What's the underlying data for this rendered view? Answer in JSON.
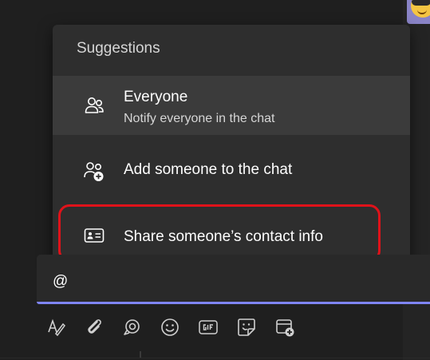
{
  "popup": {
    "title": "Suggestions",
    "items": [
      {
        "icon": "people-icon",
        "label": "Everyone",
        "sublabel": "Notify everyone in the chat"
      },
      {
        "icon": "people-add-icon",
        "label": "Add someone to the chat"
      },
      {
        "icon": "contact-card-icon",
        "label": "Share someone’s contact info"
      }
    ]
  },
  "compose": {
    "value": "@"
  },
  "toolbar": {
    "icons": [
      "format-icon",
      "attach-icon",
      "loop-icon",
      "emoji-icon",
      "gif-icon",
      "sticker-icon",
      "schedule-meeting-icon"
    ]
  },
  "colors": {
    "highlight": "#e0121a",
    "accent_underline": "#7f85f5"
  }
}
